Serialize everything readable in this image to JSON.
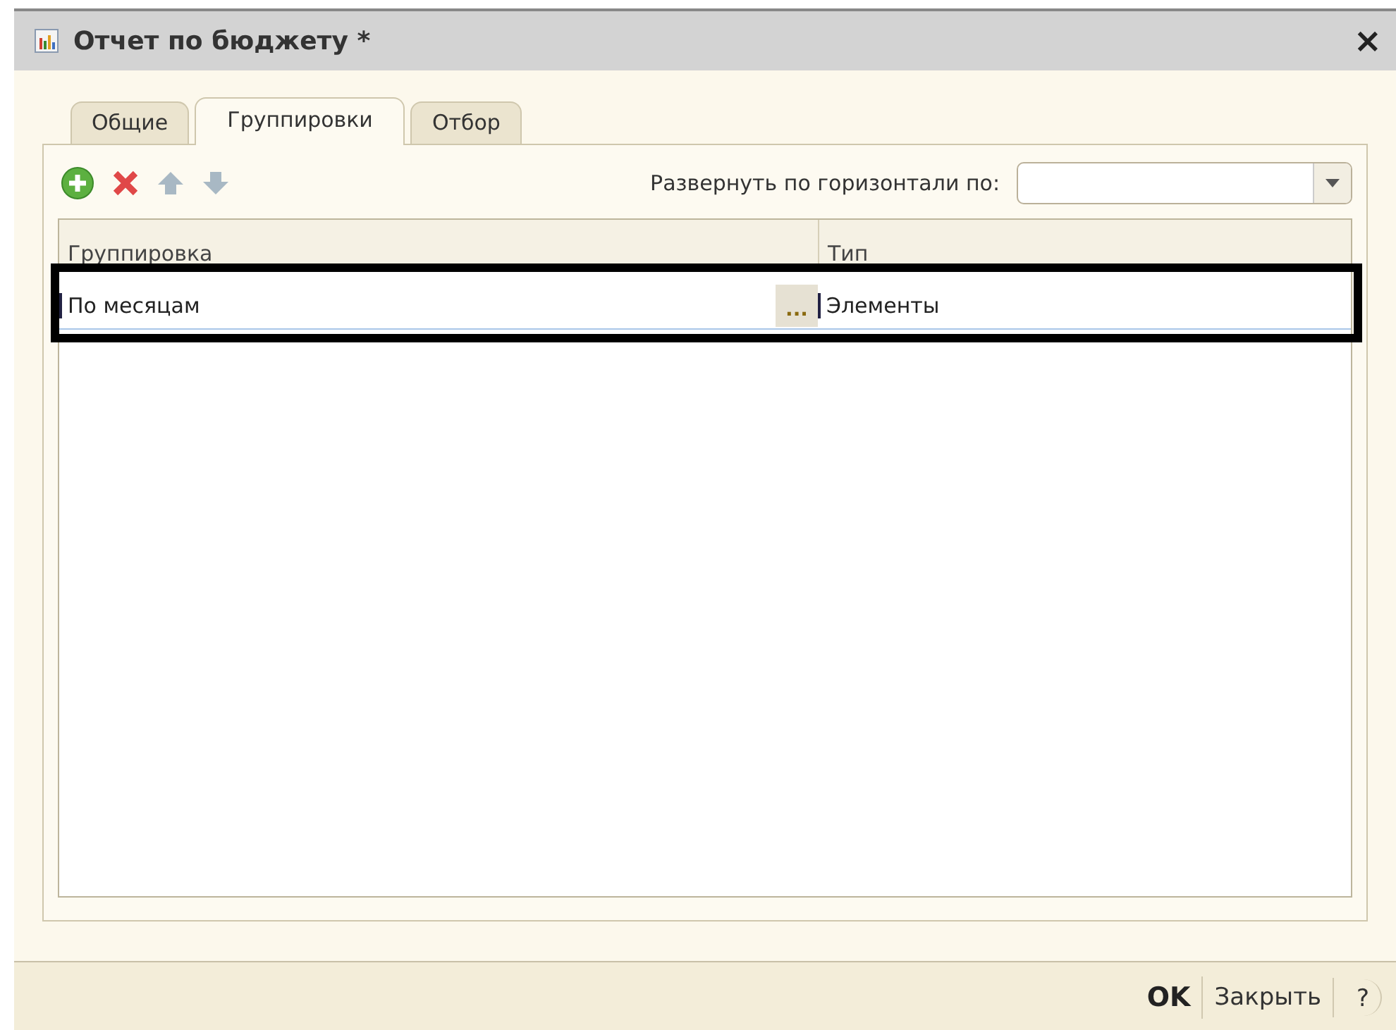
{
  "window": {
    "title": "Отчет по бюджету *",
    "close": "×"
  },
  "tabs": [
    {
      "label": "Общие",
      "selected": false
    },
    {
      "label": "Группировки",
      "selected": true
    },
    {
      "label": "Отбор",
      "selected": false
    }
  ],
  "expand": {
    "label": "Развернуть по горизонтали по:"
  },
  "table": {
    "columns": [
      "Группировка",
      "Тип"
    ],
    "rows": [
      {
        "cells": [
          "По месяцам",
          "Элементы"
        ],
        "picker": "...",
        "highlighted": true
      }
    ]
  },
  "footer": {
    "buttons": [
      {
        "label": "OK",
        "kind": "default"
      },
      {
        "label": "Закрыть",
        "kind": "normal"
      }
    ],
    "help": "?"
  }
}
